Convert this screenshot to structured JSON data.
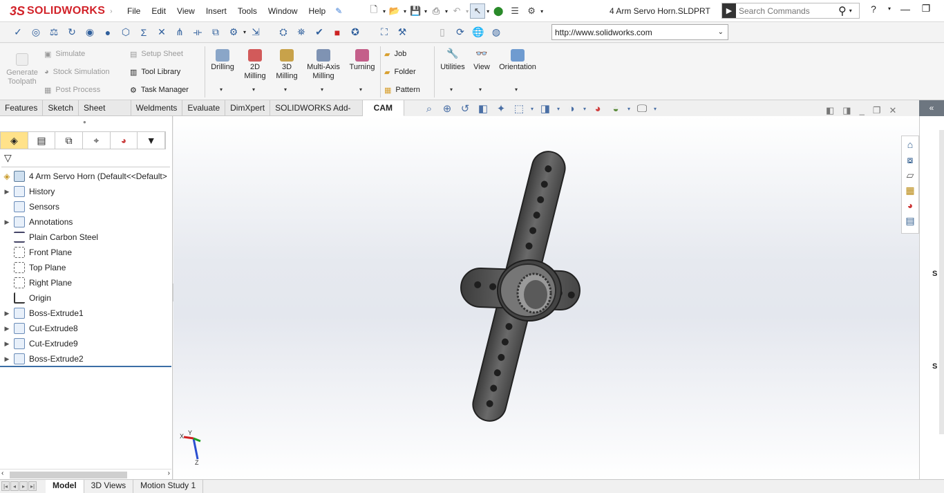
{
  "app": {
    "brand_prefix": "3S",
    "brand_name": "SOLIDWORKS",
    "brand_color": "#d2232a"
  },
  "menu": [
    "File",
    "Edit",
    "View",
    "Insert",
    "Tools",
    "Window",
    "Help"
  ],
  "document_title": "4 Arm Servo Horn.SLDPRT",
  "search": {
    "placeholder": "Search Commands"
  },
  "help_label": "?",
  "url_bar": {
    "value": "http://www.solidworks.com"
  },
  "cam_commands": {
    "generate_toolpath": "Generate Toolpath",
    "simulate": "Simulate",
    "stock_simulation": "Stock Simulation",
    "post_process": "Post Process",
    "setup_sheet": "Setup Sheet",
    "tool_library": "Tool Library",
    "task_manager": "Task Manager",
    "drilling": "Drilling",
    "milling_2d": "2D Milling",
    "milling_3d": "3D Milling",
    "multi_axis": "Multi-Axis Milling",
    "turning": "Turning",
    "job": "Job",
    "folder": "Folder",
    "pattern": "Pattern",
    "utilities": "Utilities",
    "view": "View",
    "orientation": "Orientation"
  },
  "tabs": [
    "Features",
    "Sketch",
    "Sheet Metal",
    "Weldments",
    "Evaluate",
    "DimXpert",
    "SOLIDWORKS Add-Ins",
    "CAM"
  ],
  "active_tab": "CAM",
  "feature_tree": {
    "root": "4 Arm Servo Horn  (Default<<Default>",
    "items": [
      {
        "label": "History",
        "expandable": true
      },
      {
        "label": "Sensors",
        "expandable": false
      },
      {
        "label": "Annotations",
        "expandable": true
      },
      {
        "label": "Plain Carbon Steel",
        "expandable": false
      },
      {
        "label": "Front Plane",
        "expandable": false
      },
      {
        "label": "Top Plane",
        "expandable": false
      },
      {
        "label": "Right Plane",
        "expandable": false
      },
      {
        "label": "Origin",
        "expandable": false
      },
      {
        "label": "Boss-Extrude1",
        "expandable": true
      },
      {
        "label": "Cut-Extrude8",
        "expandable": true
      },
      {
        "label": "Cut-Extrude9",
        "expandable": true
      },
      {
        "label": "Boss-Extrude2",
        "expandable": true
      }
    ]
  },
  "bottom_tabs": [
    "Model",
    "3D Views",
    "Motion Study 1"
  ],
  "active_bottom_tab": "Model",
  "triad_labels": {
    "x": "X",
    "y": "Y",
    "z": "Z"
  },
  "right_strip_letters": [
    "S",
    "S"
  ]
}
